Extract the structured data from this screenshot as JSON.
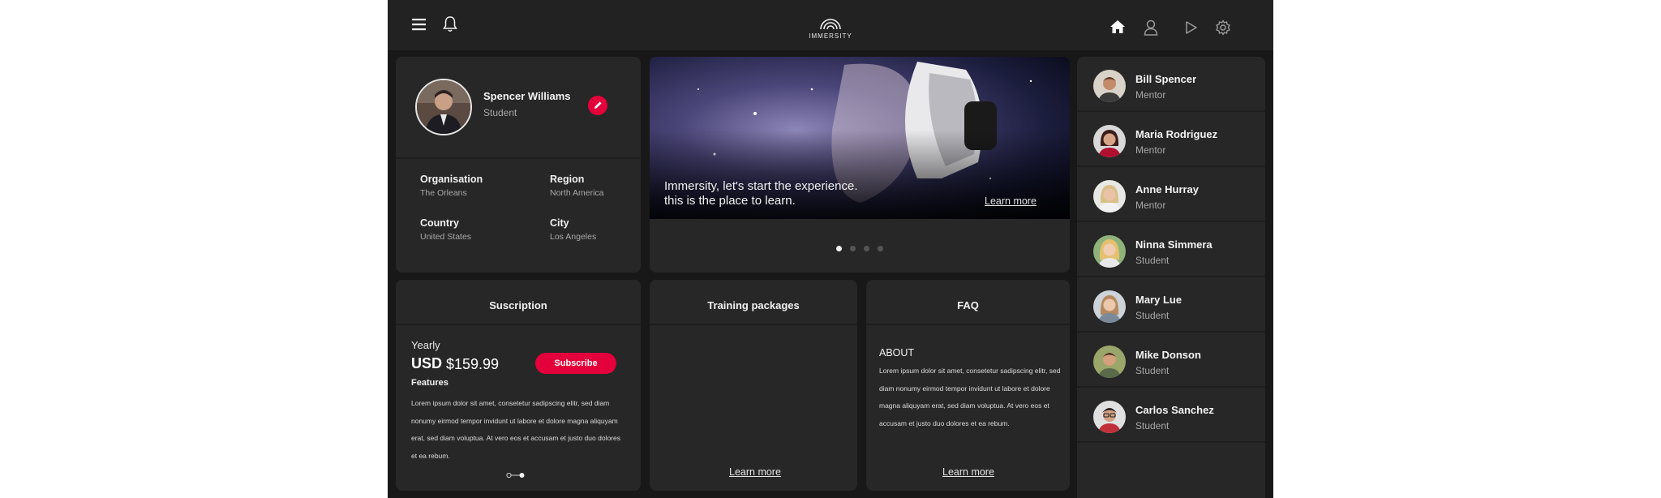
{
  "app": {
    "brand": "IMMERSITY"
  },
  "profile": {
    "name": "Spencer Williams",
    "role": "Student",
    "fields": [
      {
        "label": "Organisation",
        "value": "The Orleans"
      },
      {
        "label": "Region",
        "value": "North America"
      },
      {
        "label": "Country",
        "value": "United States"
      },
      {
        "label": "City",
        "value": "Los Angeles"
      }
    ]
  },
  "banner": {
    "line1": "Immersity, let's start the experience.",
    "line2": "this is the place to learn.",
    "link": "Learn more",
    "slide_count": 4,
    "active_slide": 1
  },
  "subscription": {
    "title": "Suscription",
    "period": "Yearly",
    "currency": "USD",
    "price": "$159.99",
    "button": "Subscribe",
    "features_label": "Features",
    "features_text": "Lorem ipsum dolor sit amet, consetetur sadipscing elitr, sed diam nonumy eirmod tempor invidunt ut labore et dolore magna aliquyam erat, sed diam voluptua. At vero eos et accusam et justo duo dolores et ea rebum.",
    "page_count": 2,
    "active_page": 2
  },
  "training": {
    "title": "Training packages",
    "link": "Learn more"
  },
  "faq": {
    "title": "FAQ",
    "heading": "ABOUT",
    "text": "Lorem ipsum dolor sit amet, consetetur sadipscing elitr, sed diam nonumy eirmod tempor invidunt ut labore et dolore magna aliquyam erat, sed diam voluptua. At vero eos et accusam et justo duo dolores et ea rebum.",
    "link": "Learn more"
  },
  "people": [
    {
      "name": "Bill Spencer",
      "role": "Mentor"
    },
    {
      "name": "Maria Rodriguez",
      "role": "Mentor"
    },
    {
      "name": "Anne Hurray",
      "role": "Mentor"
    },
    {
      "name": "Ninna Simmera",
      "role": "Student"
    },
    {
      "name": "Mary Lue",
      "role": "Student"
    },
    {
      "name": "Mike Donson",
      "role": "Student"
    },
    {
      "name": "Carlos Sanchez",
      "role": "Student"
    }
  ],
  "icons": {
    "menu": "menu-icon",
    "bell": "bell-icon",
    "logo": "immersity-logo",
    "home": "home-icon",
    "user": "user-icon",
    "play": "play-icon",
    "settings": "gear-icon",
    "edit": "pencil-icon"
  },
  "colors": {
    "accent": "#e4003a",
    "background": "#181818",
    "card": "#272727"
  }
}
